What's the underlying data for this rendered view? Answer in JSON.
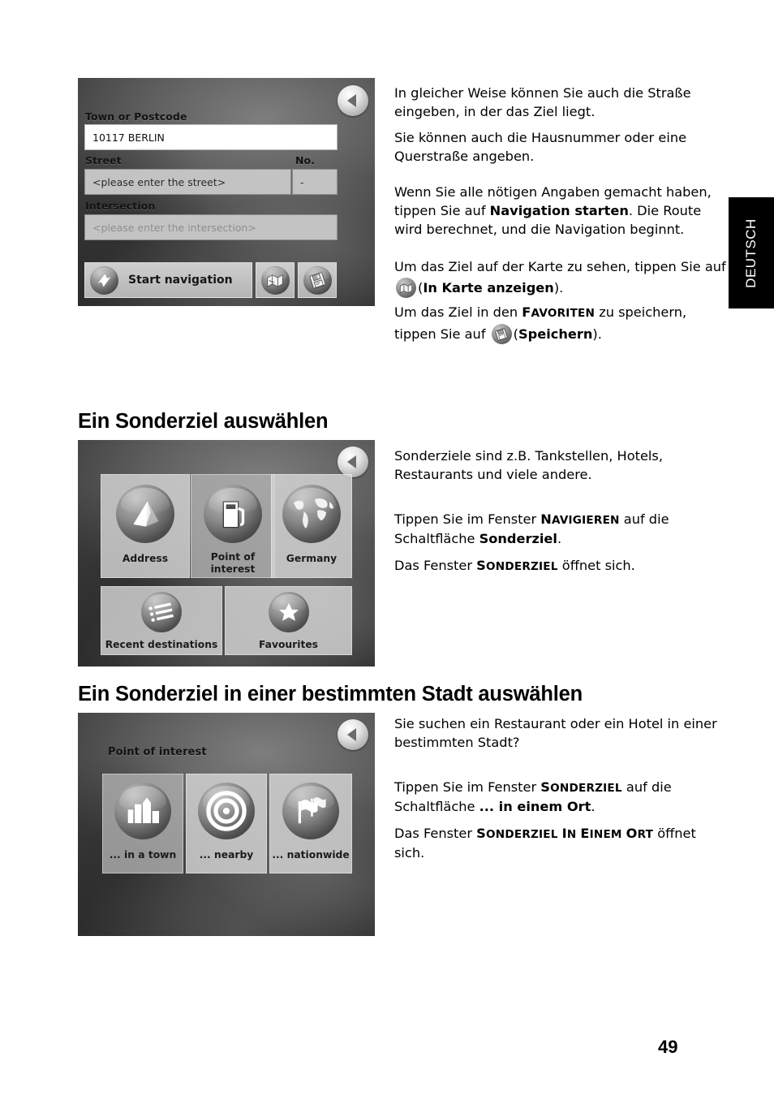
{
  "page": {
    "number": "49",
    "language_tab": "DEUTSCH"
  },
  "headings": {
    "section_1": "Ein Sonderziel auswählen",
    "section_2": "Ein Sonderziel in einer bestimmten Stadt auswählen"
  },
  "screenshot_1": {
    "name": "address-entry-screen",
    "back_button": "back-arrow",
    "labels": {
      "town": "Town or Postcode",
      "street": "Street",
      "no": "No.",
      "intersection": "Intersection"
    },
    "fields": {
      "town_value": "10117 BERLIN",
      "street_placeholder": "<please enter the street>",
      "no_value": "-",
      "intersection_placeholder": "<please enter the intersection>"
    },
    "buttons": {
      "start_navigation": "Start navigation",
      "show_on_map_icon": "map-icon",
      "save_icon": "save-icon"
    }
  },
  "screenshot_2": {
    "name": "navigate-menu-screen",
    "back_button": "back-arrow",
    "tiles": [
      {
        "label": "Address",
        "icon": "compass-arrow-icon"
      },
      {
        "label": "Point of\ninterest",
        "label_line1": "Point of",
        "label_line2": "interest",
        "icon": "fuel-pump-icon"
      },
      {
        "label": "Germany",
        "icon": "globe-icon"
      },
      {
        "label": "Recent destinations",
        "icon": "list-icon"
      },
      {
        "label": "Favourites",
        "icon": "star-icon"
      }
    ]
  },
  "screenshot_3": {
    "name": "point-of-interest-screen",
    "title": "Point of interest",
    "back_button": "back-arrow",
    "tiles": [
      {
        "label": "... in a town",
        "icon": "city-buildings-icon"
      },
      {
        "label": "... nearby",
        "icon": "target-rings-icon"
      },
      {
        "label": "... nationwide",
        "icon": "flags-icon"
      }
    ]
  },
  "body_text": {
    "p1": "In gleicher Weise können Sie auch die Straße eingeben, in der das Ziel liegt.",
    "p2": "Sie können auch die Hausnummer oder eine Querstraße angeben.",
    "p3_a": "Wenn Sie alle nötigen Angaben gemacht haben, tippen Sie auf ",
    "p3_b": "Navigation starten",
    "p3_c": ". Die Route wird berechnet, und die Navigation beginnt.",
    "p4_a": "Um das Ziel auf der Karte zu sehen, tippen Sie auf ",
    "p4_b": "(",
    "p4_c": "In Karte anzeigen",
    "p4_d": ").",
    "p5_a": "Um das Ziel in den ",
    "p5_b": "Favoriten",
    "p5_c": " zu speichern, tippen Sie auf ",
    "p5_d": "(",
    "p5_e": "Speichern",
    "p5_f": ").",
    "p6": "Sonderziele sind z.B. Tankstellen, Hotels, Restaurants und viele andere.",
    "p7_a": "Tippen Sie im Fenster ",
    "p7_b": "Navigieren",
    "p7_c": " auf die Schaltfläche ",
    "p7_d": "Sonderziel",
    "p7_e": ".",
    "p8_a": "Das Fenster ",
    "p8_b": "Sonderziel",
    "p8_c": " öffnet sich.",
    "p9": "Sie suchen ein Restaurant oder ein Hotel in einer bestimmten Stadt?",
    "p10_a": "Tippen Sie im Fenster ",
    "p10_b": "Sonderziel",
    "p10_c": " auf die Schaltfläche ",
    "p10_d": "... in einem Ort",
    "p10_e": ".",
    "p11_a": "Das Fenster ",
    "p11_b": "Sonderziel in einem Ort",
    "p11_c": " öffnet sich."
  }
}
